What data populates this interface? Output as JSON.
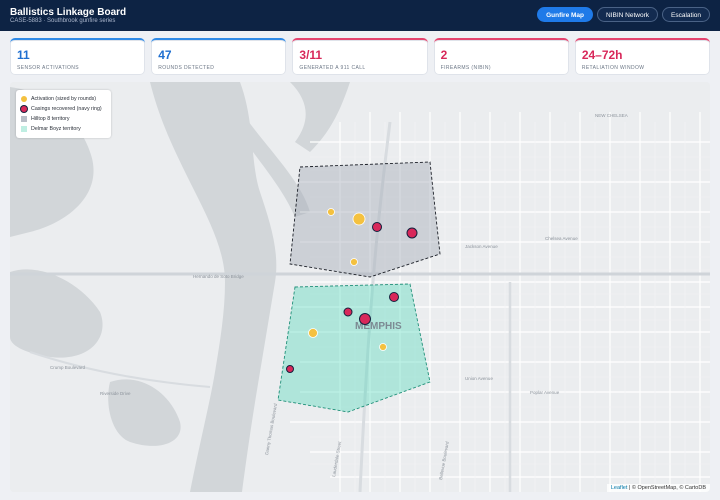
{
  "header": {
    "title": "Ballistics Linkage Board",
    "subtitle": "CASE-5883 · Southbrook gunfire series",
    "nav": [
      "Gunfire Map",
      "NIBIN Network",
      "Escalation"
    ]
  },
  "kpis": [
    {
      "value": "11",
      "label": "Sensor activations"
    },
    {
      "value": "47",
      "label": "Rounds detected"
    },
    {
      "value": "3/11",
      "label": "Generated a 911 call"
    },
    {
      "value": "2",
      "label": "Firearms (NIBIN)"
    },
    {
      "value": "24–72h",
      "label": "Retaliation window"
    }
  ],
  "legend": [
    "Activation (sized by rounds)",
    "Casings recovered (navy ring)",
    "Hilltop 8 territory",
    "Delmar Boyz territory"
  ],
  "map": {
    "city_label": "MEMPHIS",
    "road_labels": [
      "Hernando de Soto Bridge",
      "Jackson Avenue",
      "Chelsea Avenue",
      "NEW CHELSEA",
      "Union Avenue",
      "Poplar Avenue",
      "Crump Boulevard",
      "Riverside Drive",
      "Danny Thomas Boulevard",
      "Lauderdale Street",
      "Bellevue Boulevard"
    ],
    "attribution_link": "Leaflet",
    "attribution_text": "| © OpenStreetMap, © CartoDB"
  },
  "colors": {
    "activation": "#f4c13f",
    "casings": "#d8285a",
    "hilltop": "#a7adb8",
    "delmar": "#3fd6b4",
    "header_bg": "#0d2344",
    "accent": "#1f7ae8"
  }
}
